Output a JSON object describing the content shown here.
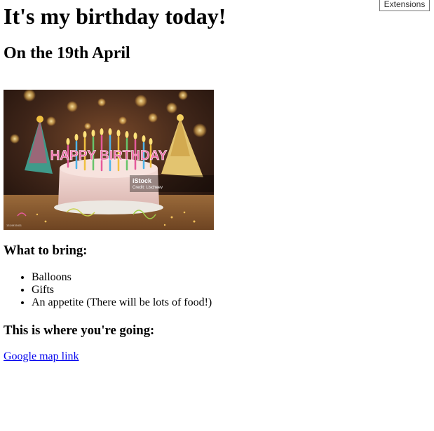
{
  "extensions_button": {
    "label": "Extensions"
  },
  "page": {
    "title": "It's my birthday today!",
    "subtitle": "On the 19th April"
  },
  "hero_image": {
    "banner_text": "HAPPY BIRTHDAY",
    "watermark_brand": "iStock",
    "watermark_credit": "Credit: Lischeev",
    "watermark_id": "1314915411"
  },
  "bring_section": {
    "heading": "What to bring:",
    "items": [
      "Balloons",
      "Gifts",
      "An appetite (There will be lots of food!)"
    ]
  },
  "location_section": {
    "heading": "This is where you're going:",
    "link_text": "Google map link"
  }
}
